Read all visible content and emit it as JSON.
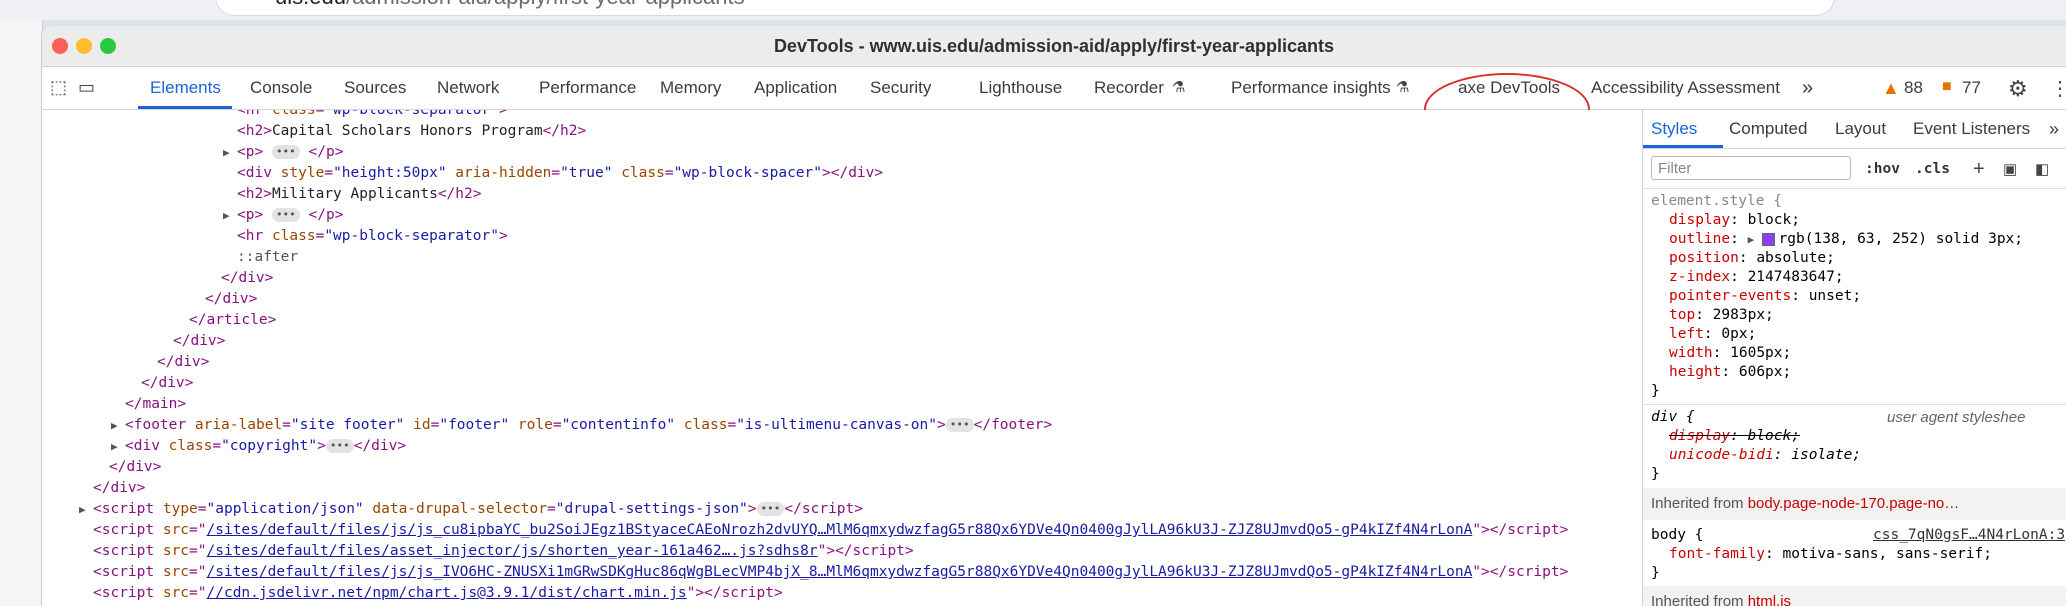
{
  "browser": {
    "address_domain": "uis.edu",
    "address_path": "/admission-aid/apply/first-year-applicants"
  },
  "devtools": {
    "window_title": "DevTools - www.uis.edu/admission-aid/apply/first-year-applicants",
    "tabs": [
      "Elements",
      "Console",
      "Sources",
      "Network",
      "Performance",
      "Memory",
      "Application",
      "Security",
      "Lighthouse",
      "Recorder",
      "Performance insights",
      "axe DevTools",
      "Accessibility Assessment"
    ],
    "more_tabs": "»",
    "warnings_count": "88",
    "issues_count": "77"
  },
  "elements": {
    "l1_tag": "hr",
    "l1_attr": "class",
    "l1_val": "\"wp-block-separator\"",
    "l2_open": "h2",
    "l2_text": "Capital Scholars Honors Program",
    "l3_tag": "p",
    "l4_tag": "div",
    "l4_a1": "style",
    "l4_v1": "\"height:50px\"",
    "l4_a2": "aria-hidden",
    "l4_v2": "\"true\"",
    "l4_a3": "class",
    "l4_v3": "\"wp-block-spacer\"",
    "l5_open": "h2",
    "l5_text": "Military Applicants",
    "l6_tag": "p",
    "l7_tag": "hr",
    "l7_attr": "class",
    "l7_val": "\"wp-block-separator\"",
    "l8_pseudo": "::after",
    "l9": "div",
    "l10": "div",
    "l11": "article",
    "l12": "div",
    "l13": "div",
    "l14": "div",
    "l15": "main",
    "l16_tag": "footer",
    "l16_a1": "aria-label",
    "l16_v1": "\"site footer\"",
    "l16_a2": "id",
    "l16_v2": "\"footer\"",
    "l16_a3": "role",
    "l16_v3": "\"contentinfo\"",
    "l16_a4": "class",
    "l16_v4": "\"is-ultimenu-canvas-on\"",
    "l17_tag": "div",
    "l17_a1": "class",
    "l17_v1": "\"copyright\"",
    "l18": "div",
    "l19": "div",
    "l20_tag": "script",
    "l20_a1": "type",
    "l20_v1": "\"application/json\"",
    "l20_a2": "data-drupal-selector",
    "l20_v2": "\"drupal-settings-json\"",
    "l21_link": "/sites/default/files/js/js_cu8ipbaYC_bu2SoiJEgz1BStyaceCAEoNrozh2dvUYQ…MlM6qmxydwzfagG5r88Qx6YDVe4Qn0400gJylLA96kU3J-ZJZ8UJmvdQo5-gP4kIZf4N4rLonA",
    "l22_link": "/sites/default/files/asset_injector/js/shorten_year-161a462….js?sdhs8r",
    "l23_link": "/sites/default/files/js/js_IVO6HC-ZNUSXi1mGRwSDKgHuc86qWgBLecVMP4bjX_8…MlM6qmxydwzfagG5r88Qx6YDVe4Qn0400gJylLA96kU3J-ZJZ8UJmvdQo5-gP4kIZf4N4rLonA",
    "l24_link": "//cdn.jsdelivr.net/npm/chart.js@3.9.1/dist/chart.min.js"
  },
  "styles": {
    "tabs": [
      "Styles",
      "Computed",
      "Layout",
      "Event Listeners"
    ],
    "filter_placeholder": "Filter",
    "hov": ":hov",
    "cls": ".cls",
    "element_selector": "element.style {",
    "rules": [
      {
        "p": "display",
        "v": "block;"
      },
      {
        "p": "outline",
        "v": "rgb(138, 63, 252) solid 3px;"
      },
      {
        "p": "position",
        "v": "absolute;"
      },
      {
        "p": "z-index",
        "v": "2147483647;"
      },
      {
        "p": "pointer-events",
        "v": "unset;"
      },
      {
        "p": "top",
        "v": "2983px;"
      },
      {
        "p": "left",
        "v": "0px;"
      },
      {
        "p": "width",
        "v": "1605px;"
      },
      {
        "p": "height",
        "v": "606px;"
      }
    ],
    "close_brace": "}",
    "div_selector": "div {",
    "ua_label": "user agent styleshee",
    "div_rules": [
      {
        "p": "display",
        "v": "block;"
      },
      {
        "p": "unicode-bidi",
        "v": "isolate;"
      }
    ],
    "inherited_from_label": "Inherited from",
    "inherited1": "body.page-node-170.page-no…",
    "body_selector": "body {",
    "body_source": "css_7qN0gsF…4N4rLonA:3",
    "body_rules": [
      {
        "p": "font-family",
        "v": "motiva-sans, sans-serif;"
      }
    ],
    "inherited2": "html.js"
  },
  "colors": {
    "accent": "#1a63d8",
    "tag": "#881280",
    "attr": "#994500",
    "value": "#1a1aa6",
    "annotation": "#d7332a",
    "swatch": "#8a3ffc"
  }
}
